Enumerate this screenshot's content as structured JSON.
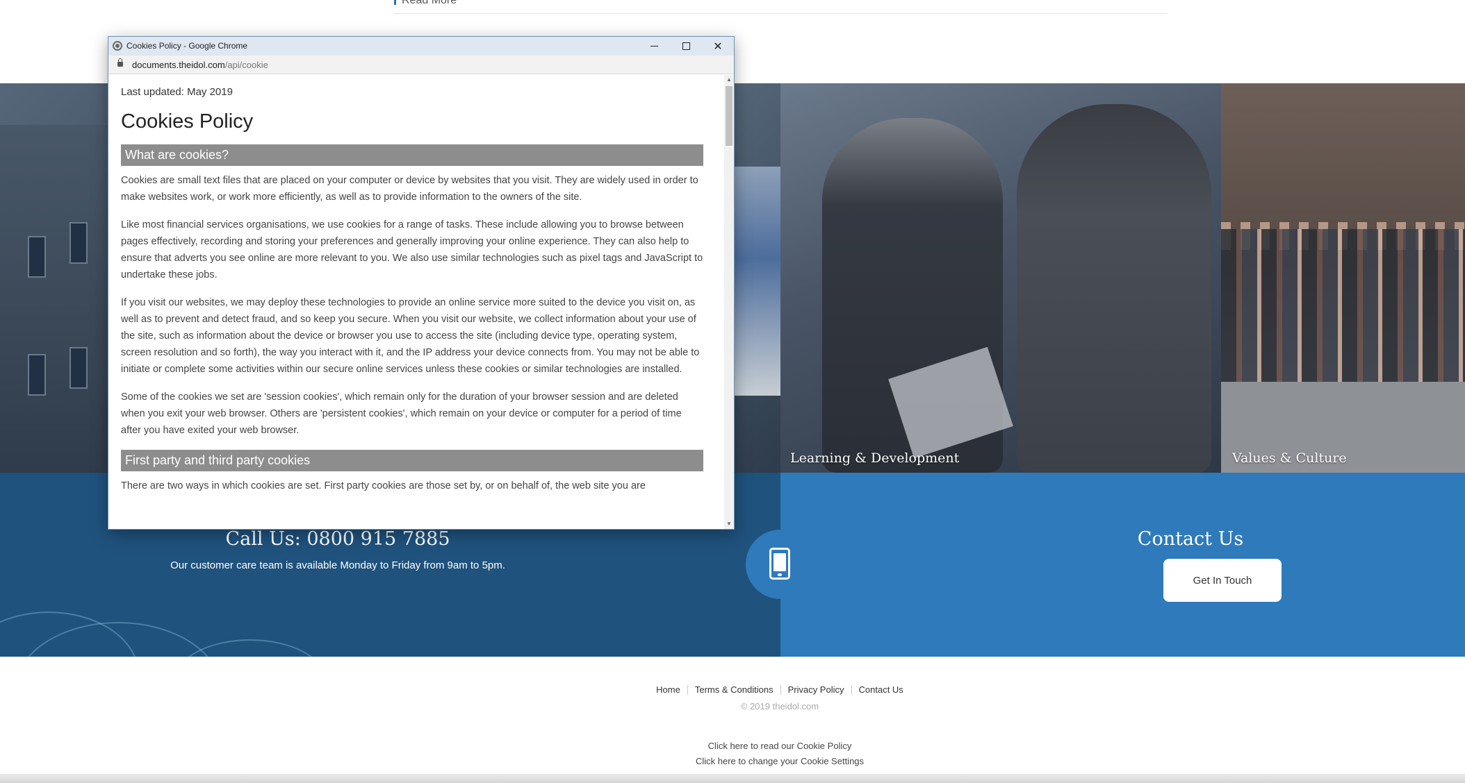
{
  "top": {
    "read_more": "Read More"
  },
  "tiles": [
    {
      "label": "Learning & Development"
    },
    {
      "label": "Values & Culture"
    }
  ],
  "call_band": {
    "title": "Call Us: 0800 915 7885",
    "subtitle": "Our customer care team is available Monday to Friday from 9am to 5pm.",
    "icon": "mobile-phone-icon",
    "left_color": "#1f527d",
    "right_color": "#2e7abb"
  },
  "contact": {
    "title": "Contact Us",
    "button": "Get In Touch"
  },
  "footer": {
    "links": [
      "Home",
      "Terms & Conditions",
      "Privacy Policy",
      "Contact Us"
    ],
    "copyright": "© 2019 theidol.com",
    "cookie_policy_link": "Click here to read our Cookie Policy",
    "cookie_settings_link": "Click here to change your Cookie Settings"
  },
  "popup": {
    "window_title": "Cookies Policy - Google Chrome",
    "url_host": "documents.theidol.com",
    "url_path": "/api/cookie",
    "last_updated": "Last updated: May 2019",
    "heading": "Cookies Policy",
    "section1_title": "What are cookies?",
    "paragraphs": [
      "Cookies are small text files that are placed on your computer or device by websites that you visit. They are widely used in order to make websites work, or work more efficiently, as well as to provide information to the owners of the site.",
      "Like most financial services organisations, we use cookies for a range of tasks. These include allowing you to browse between pages effectively, recording and storing your preferences and generally improving your online experience. They can also help to ensure that adverts you see online are more relevant to you. We also use similar technologies such as pixel tags and JavaScript to undertake these jobs.",
      "If you visit our websites, we may deploy these technologies to provide an online service more suited to the device you visit on, as well as to prevent and detect fraud, and so keep you secure. When you visit our website, we collect information about your use of the site, such as information about the device or browser you use to access the site (including device type, operating system, screen resolution and so forth), the way you interact with it, and the IP address your device connects from. You may not be able to initiate or complete some activities within our secure online services unless these cookies or similar technologies are installed.",
      "Some of the cookies we set are 'session cookies', which remain only for the duration of your browser session and are deleted when you exit your web browser. Others are 'persistent cookies', which remain on your device or computer for a period of time after you have exited your web browser."
    ],
    "section2_title": "First party and third party cookies",
    "section2_first_line": "There are two ways in which cookies are set. First party cookies are those set by, or on behalf of, the web site you are",
    "controls": {
      "minimize": "minimize-icon",
      "maximize": "maximize-icon",
      "close": "close-icon"
    }
  }
}
